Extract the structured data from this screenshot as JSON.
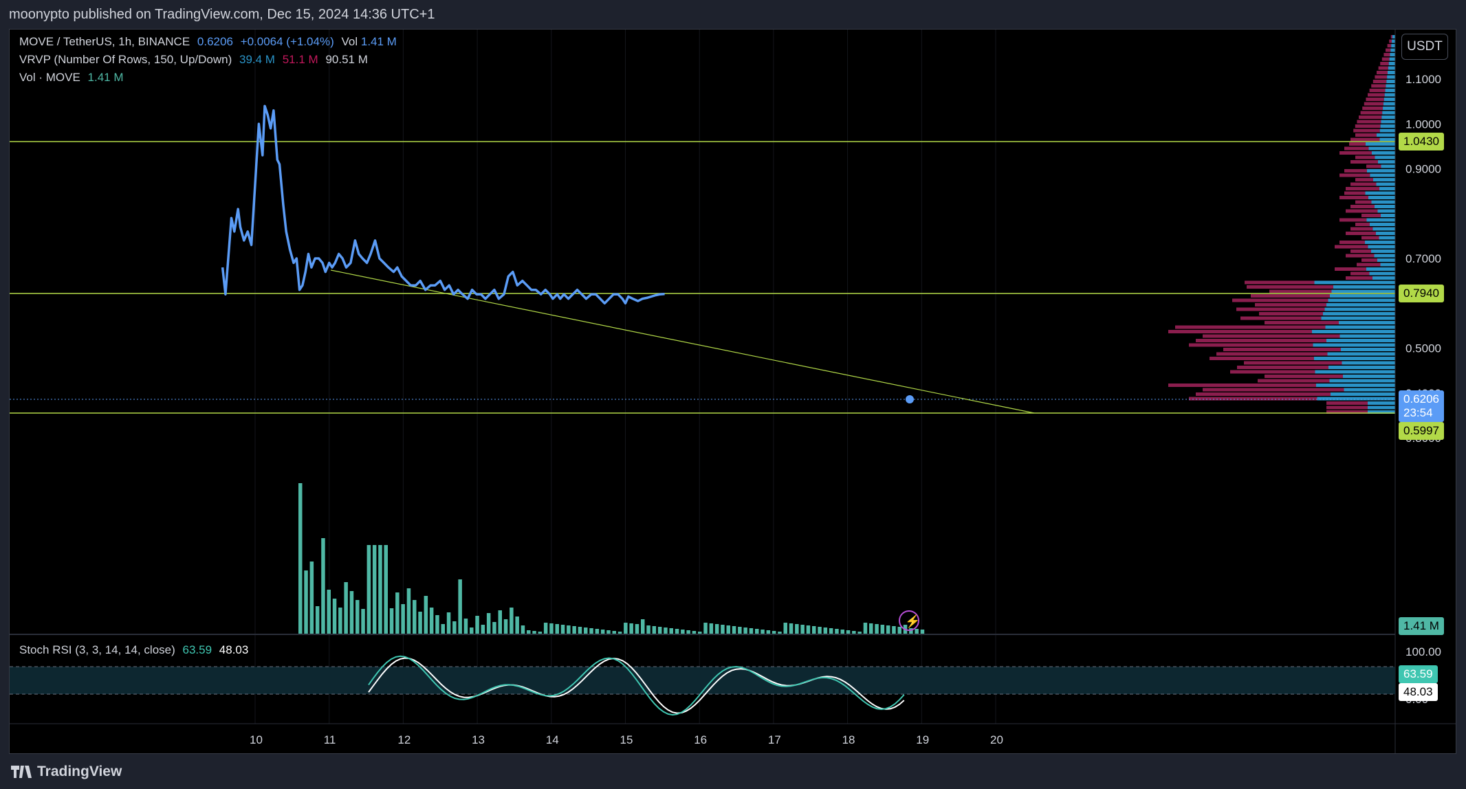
{
  "publisher": "moonypto published on TradingView.com, Dec 15, 2024 14:36 UTC+1",
  "footer_brand": "TradingView",
  "currency_button": "USDT",
  "legend": {
    "symbol": "MOVE / TetherUS, 1h, BINANCE",
    "price": "0.6206",
    "change": "+0.0064 (+1.04%)",
    "vol_label": "Vol",
    "vol_value": "1.41 M",
    "vrvp_label": "VRVP (Number Of Rows, 150, Up/Down)",
    "vrvp_up": "39.4 M",
    "vrvp_down": "51.1 M",
    "vrvp_total": "90.51 M",
    "vol_ind_label": "Vol · MOVE",
    "vol_ind_value": "1.41 M"
  },
  "stoch": {
    "label": "Stoch RSI (3, 3, 14, 14, close)",
    "k": "63.59",
    "d": "48.03"
  },
  "price_axis_ticks": [
    "1.1000",
    "1.0000",
    "0.9000",
    "0.7000",
    "0.5000",
    "0.4000",
    "0.3000"
  ],
  "price_labels": {
    "h1": "1.0430",
    "h2": "0.7940",
    "last": "0.6206",
    "countdown": "23:54",
    "h3": "0.5997",
    "vol": "1.41 M"
  },
  "stoch_axis": {
    "top": "100.00",
    "bottom": "0.00",
    "k": "63.59",
    "d": "48.03"
  },
  "time_axis": [
    "10",
    "11",
    "12",
    "13",
    "14",
    "15",
    "16",
    "17",
    "18",
    "19",
    "20"
  ],
  "colors": {
    "line": "#5b9cf6",
    "hline": "#b2d948",
    "vol": "#4fb8a5",
    "vrvp_up": "#2a93c7",
    "vrvp_down": "#8b1e4e",
    "stoch_k": "#3fc6b1",
    "stoch_d": "#ffffff"
  },
  "chart_data": {
    "type": "line",
    "x": [
      9.56,
      9.6,
      9.68,
      9.72,
      9.77,
      9.8,
      9.85,
      9.9,
      9.95,
      10.05,
      10.1,
      10.13,
      10.17,
      10.21,
      10.25,
      10.3,
      10.33,
      10.38,
      10.42,
      10.47,
      10.52,
      10.56,
      10.6,
      10.64,
      10.68,
      10.72,
      10.76,
      10.81,
      10.86,
      10.91,
      10.95,
      11.0,
      11.04,
      11.08,
      11.13,
      11.18,
      11.23,
      11.29,
      11.35,
      11.4,
      11.45,
      11.51,
      11.56,
      11.62,
      11.68,
      11.74,
      11.8,
      11.87,
      11.92,
      11.98,
      12.04,
      12.1,
      12.17,
      12.23,
      12.3,
      12.37,
      12.43,
      12.5,
      12.56,
      12.62,
      12.68,
      12.74,
      12.8,
      12.87,
      12.93,
      12.99,
      13.05,
      13.11,
      13.17,
      13.23,
      13.29,
      13.36,
      13.42,
      13.48,
      13.54,
      13.61,
      13.67,
      13.73,
      13.79,
      13.86,
      13.92,
      13.98,
      14.02,
      14.08,
      14.12,
      14.17,
      14.23,
      14.29,
      14.35,
      14.41,
      14.47,
      14.54,
      14.6,
      14.66,
      14.72,
      14.78,
      14.84,
      14.9,
      14.96,
      15.0,
      15.04,
      15.1,
      15.17,
      15.23,
      15.29,
      15.35,
      15.41,
      15.47,
      15.53,
      15.59
    ],
    "y": [
      0.68,
      0.62,
      0.79,
      0.76,
      0.81,
      0.77,
      0.74,
      0.76,
      0.73,
      1.0,
      0.93,
      1.04,
      1.02,
      0.99,
      1.03,
      0.92,
      0.91,
      0.82,
      0.76,
      0.72,
      0.69,
      0.7,
      0.63,
      0.64,
      0.67,
      0.71,
      0.68,
      0.7,
      0.7,
      0.69,
      0.67,
      0.69,
      0.68,
      0.69,
      0.71,
      0.7,
      0.68,
      0.69,
      0.74,
      0.71,
      0.7,
      0.69,
      0.71,
      0.74,
      0.7,
      0.69,
      0.68,
      0.67,
      0.68,
      0.66,
      0.65,
      0.64,
      0.64,
      0.65,
      0.63,
      0.64,
      0.64,
      0.65,
      0.63,
      0.64,
      0.62,
      0.63,
      0.62,
      0.61,
      0.63,
      0.62,
      0.62,
      0.61,
      0.62,
      0.63,
      0.61,
      0.62,
      0.66,
      0.67,
      0.64,
      0.65,
      0.64,
      0.63,
      0.63,
      0.62,
      0.63,
      0.62,
      0.61,
      0.62,
      0.61,
      0.62,
      0.61,
      0.62,
      0.63,
      0.62,
      0.61,
      0.62,
      0.62,
      0.61,
      0.6,
      0.61,
      0.62,
      0.62,
      0.61,
      0.6,
      0.615,
      0.61,
      0.605,
      0.61,
      0.612,
      0.615,
      0.618,
      0.62,
      0.6206
    ],
    "ylim": [
      0.28,
      1.2
    ],
    "xlim": [
      6.3,
      20.45
    ],
    "hlines": [
      1.043,
      0.794,
      0.5997
    ],
    "trendline": {
      "x": [
        9.85,
        16.8
      ],
      "y": [
        0.78,
        0.5997
      ]
    },
    "volume": [
      12,
      3,
      8,
      2,
      5,
      1,
      7,
      2,
      4,
      6,
      1,
      9,
      10,
      8,
      6,
      5,
      3,
      4,
      7,
      3,
      2,
      2,
      1,
      1,
      1,
      1,
      1,
      1,
      1,
      1,
      1,
      1,
      1,
      1,
      1,
      1,
      1,
      1,
      1,
      1,
      1,
      1,
      1,
      1,
      1,
      1,
      1,
      1,
      1,
      1,
      1
    ],
    "stoch_k": [
      63.59
    ],
    "stoch_d": [
      48.03
    ]
  }
}
